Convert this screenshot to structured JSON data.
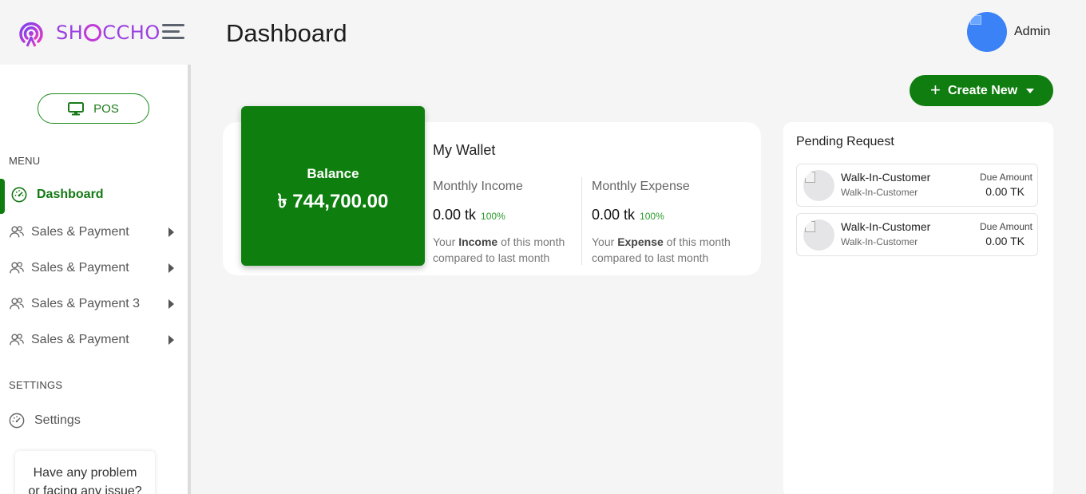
{
  "brand": {
    "name_prefix": "SH",
    "name_suffix": "CCHO"
  },
  "header": {
    "title": "Dashboard",
    "user_name": "Admin"
  },
  "sidebar": {
    "pos_label": "POS",
    "menu_label": "MENU",
    "items": [
      {
        "label": "Dashboard",
        "icon": "dashboard-gauge-icon",
        "active": true
      },
      {
        "label": "Sales & Payment",
        "icon": "users-icon"
      },
      {
        "label": "Sales & Payment",
        "icon": "users-icon"
      },
      {
        "label": "Sales & Payment 3",
        "icon": "users-icon"
      },
      {
        "label": "Sales & Payment",
        "icon": "users-icon"
      }
    ],
    "settings_label": "SETTINGS",
    "settings_item": {
      "label": "Settings",
      "icon": "gauge-icon"
    },
    "help": {
      "line1": "Have any problem",
      "line2": "or facing any issue?"
    }
  },
  "toolbar": {
    "create_label": "Create New"
  },
  "wallet": {
    "balance_label": "Balance",
    "balance_amount": "৳ 744,700.00",
    "title": "My Wallet",
    "income": {
      "title": "Monthly Income",
      "value": "0.00 tk",
      "pct": "100%",
      "note_pre": "Your ",
      "note_bold": "Income",
      "note_post": " of this month",
      "note_line2": "compared to last month"
    },
    "expense": {
      "title": "Monthly Expense",
      "value": "0.00 tk",
      "pct": "100%",
      "note_pre": "Your ",
      "note_bold": "Expense",
      "note_post": " of this month",
      "note_line2": "compared to last month"
    }
  },
  "pending": {
    "title": "Pending Request",
    "items": [
      {
        "name": "Walk-In-Customer",
        "sub": "Walk-In-Customer",
        "due_label": "Due Amount",
        "due_value": "0.00 TK"
      },
      {
        "name": "Walk-In-Customer",
        "sub": "Walk-In-Customer",
        "due_label": "Due Amount",
        "due_value": "0.00 TK"
      }
    ]
  },
  "colors": {
    "primary": "#0e7f0e",
    "brand_purple": "#9b3fe0",
    "avatar_blue": "#3b82f6"
  }
}
